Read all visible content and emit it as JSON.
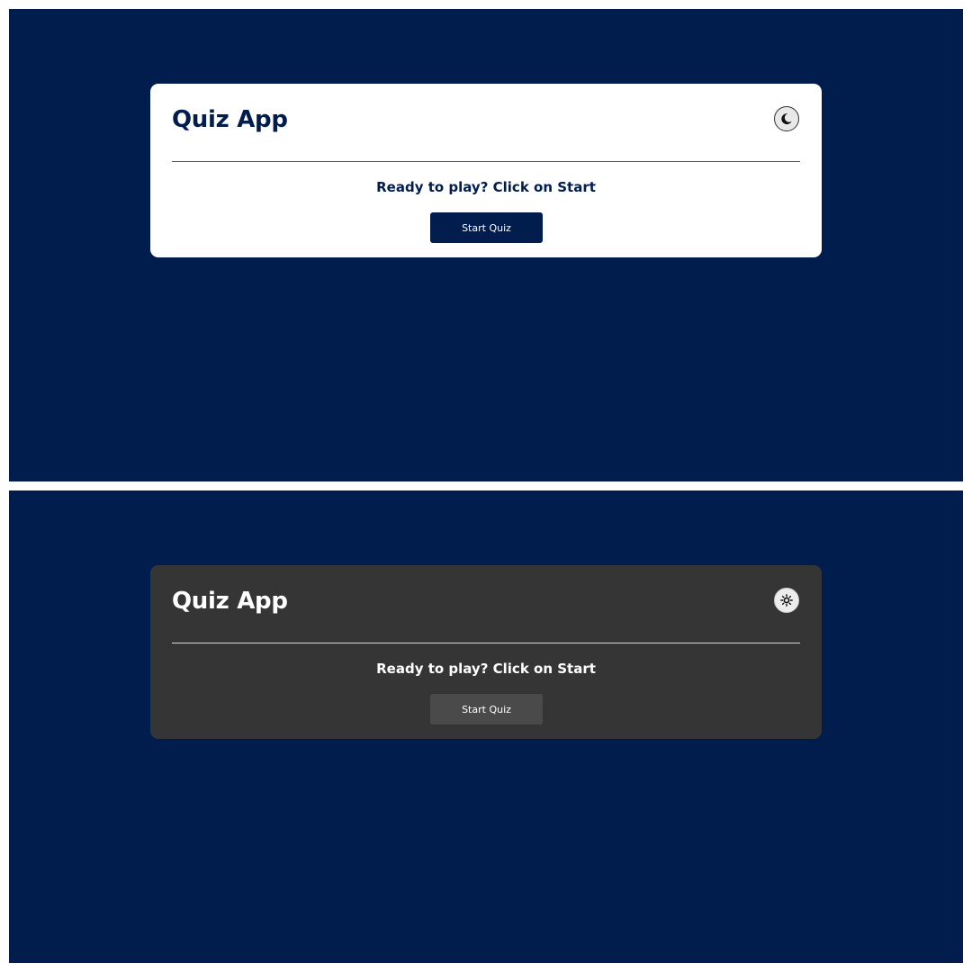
{
  "screens": [
    {
      "theme": "light",
      "title": "Quiz App",
      "toggle_icon": "moon-icon",
      "prompt": "Ready to play? Click on Start",
      "start_label": "Start Quiz"
    },
    {
      "theme": "dark",
      "title": "Quiz App",
      "toggle_icon": "sun-icon",
      "prompt": "Ready to play? Click on Start",
      "start_label": "Start Quiz"
    }
  ],
  "colors": {
    "page_background": "#001d4d",
    "light_card": "#ffffff",
    "dark_card": "#353535",
    "light_button": "#001d4d",
    "dark_button": "#4a4a4a"
  }
}
